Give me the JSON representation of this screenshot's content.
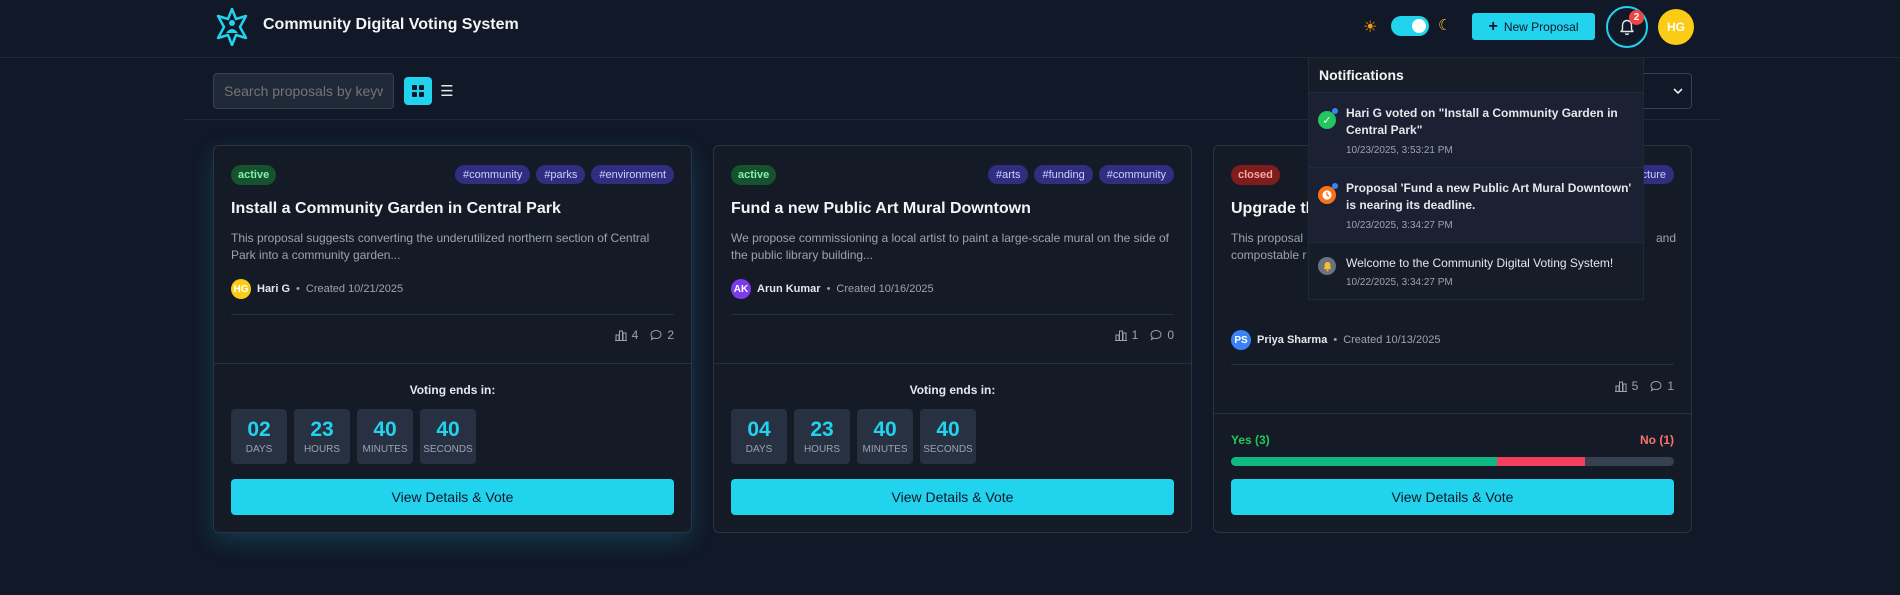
{
  "header": {
    "title": "Community Digital Voting System",
    "theme_toggle_on": true,
    "new_proposal_label": "New Proposal",
    "notification_count": "2",
    "user_initials": "HG"
  },
  "toolbar": {
    "search_placeholder": "Search proposals by keyword",
    "view_mode": "grid"
  },
  "proposals": [
    {
      "status": "active",
      "tags": [
        "#community",
        "#parks",
        "#environment"
      ],
      "title": "Install a Community Garden in Central Park",
      "description": "This proposal suggests converting the underutilized northern section of Central Park into a community garden...",
      "author_initials": "HG",
      "author": "Hari G",
      "created": "Created 10/21/2025",
      "votes": "4",
      "comments": "2",
      "voting_label": "Voting ends in:",
      "countdown": [
        {
          "value": "02",
          "unit": "DAYS"
        },
        {
          "value": "23",
          "unit": "HOURS"
        },
        {
          "value": "40",
          "unit": "MINUTES"
        },
        {
          "value": "40",
          "unit": "SECONDS"
        }
      ],
      "button": "View Details & Vote"
    },
    {
      "status": "active",
      "tags": [
        "#arts",
        "#funding",
        "#community"
      ],
      "title": "Fund a new Public Art Mural Downtown",
      "description": "We propose commissioning a local artist to paint a large-scale mural on the side of the public library building...",
      "author_initials": "AK",
      "author": "Arun Kumar",
      "created": "Created 10/16/2025",
      "votes": "1",
      "comments": "0",
      "voting_label": "Voting ends in:",
      "countdown": [
        {
          "value": "04",
          "unit": "DAYS"
        },
        {
          "value": "23",
          "unit": "HOURS"
        },
        {
          "value": "40",
          "unit": "MINUTES"
        },
        {
          "value": "40",
          "unit": "SECONDS"
        }
      ],
      "button": "View Details & Vote"
    },
    {
      "status": "closed",
      "tags": [
        "cture"
      ],
      "title": "Upgrade th",
      "description_line1": "This proposal",
      "description_line1_end": "and",
      "description_line2": "compostable r",
      "author_initials": "PS",
      "author": "Priya Sharma",
      "created": "Created 10/13/2025",
      "votes": "5",
      "comments": "1",
      "yes_label": "Yes (3)",
      "no_label": "No (1)",
      "yes_fraction": 0.6,
      "no_fraction": 0.2,
      "button": "View Details & Vote"
    }
  ],
  "notifications": {
    "title": "Notifications",
    "items": [
      {
        "text": "Hari G voted on \"Install a Community Garden in Central Park\"",
        "time": "10/23/2025, 3:53:21 PM",
        "unread": true,
        "icon": "check-icon"
      },
      {
        "text": "Proposal 'Fund a new Public Art Mural Downtown' is nearing its deadline.",
        "time": "10/23/2025, 3:34:27 PM",
        "unread": true,
        "icon": "clock-icon"
      },
      {
        "text": "Welcome to the Community Digital Voting System!",
        "time": "10/22/2025, 3:34:27 PM",
        "unread": false,
        "icon": "bell-icon"
      }
    ]
  },
  "colors": {
    "accent": "#22d3ee",
    "background": "#111827",
    "card": "#151b26",
    "active_badge": "#14532d",
    "closed_badge": "#7f1d1d",
    "yes": "#10b981",
    "no": "#f43f5e"
  }
}
